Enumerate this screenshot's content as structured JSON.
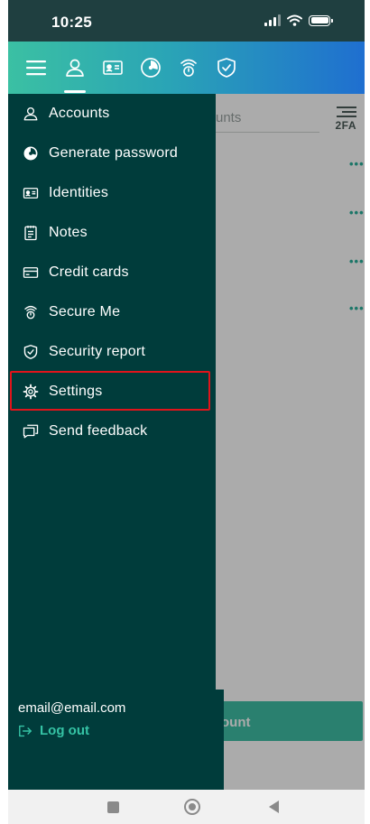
{
  "status_bar": {
    "time": "10:25"
  },
  "toolbar": {
    "icons": [
      "menu-icon",
      "accounts-icon",
      "identities-icon",
      "generate-password-icon",
      "secure-me-icon",
      "security-report-icon"
    ],
    "active": "accounts"
  },
  "background": {
    "search_partial": "unts",
    "twofa_label": "2FA",
    "row_more": "•••",
    "add_button_partial": "ount"
  },
  "drawer": {
    "items": [
      {
        "label": "Accounts",
        "icon": "user-icon"
      },
      {
        "label": "Generate password",
        "icon": "generate-password-icon"
      },
      {
        "label": "Identities",
        "icon": "id-card-icon"
      },
      {
        "label": "Notes",
        "icon": "notes-icon"
      },
      {
        "label": "Credit cards",
        "icon": "credit-card-icon"
      },
      {
        "label": "Secure Me",
        "icon": "secure-me-icon"
      },
      {
        "label": "Security report",
        "icon": "shield-icon"
      },
      {
        "label": "Settings",
        "icon": "gear-icon"
      },
      {
        "label": "Send feedback",
        "icon": "feedback-icon"
      }
    ],
    "highlighted": "Settings",
    "email": "email@email.com",
    "logout_label": "Log out"
  },
  "colors": {
    "drawer_bg": "#003c3b",
    "accent": "#35c3a5",
    "highlight_border": "#e0141b",
    "toolbar_gradient_start": "#3bc0a3",
    "toolbar_gradient_end": "#1f6fd0"
  }
}
